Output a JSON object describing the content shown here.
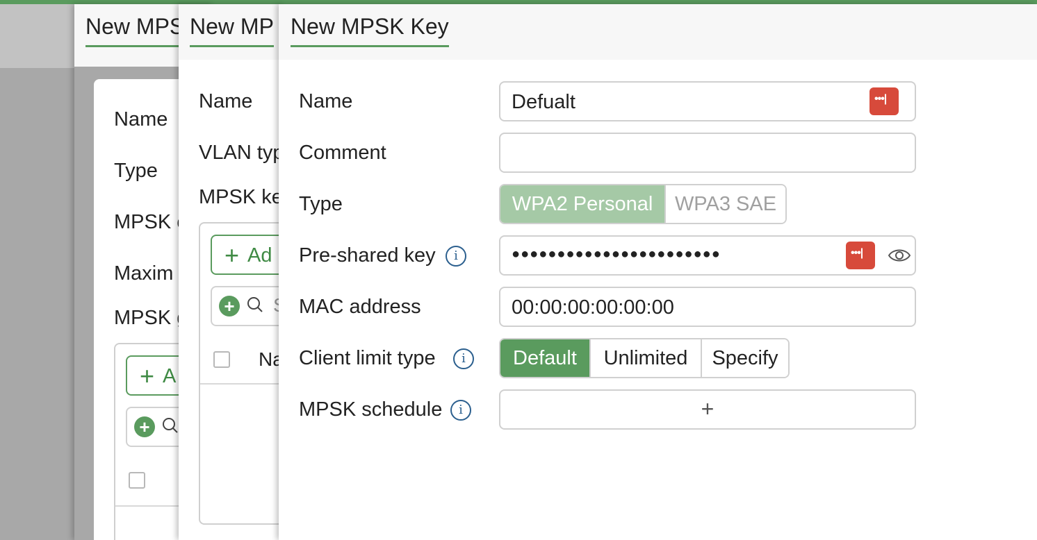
{
  "panels": {
    "back": {
      "title": "New MPS",
      "labels": [
        "Name",
        "Type",
        "MPSK c",
        "Maxim",
        "MPSK g"
      ],
      "add_label": "A",
      "checkbox_header": ""
    },
    "middle": {
      "title": "New MP",
      "labels": [
        "Name",
        "VLAN typ",
        "MPSK ke"
      ],
      "add_label": "Ad",
      "search_partial": "S",
      "column_header": "Na"
    },
    "front": {
      "title": "New MPSK Key",
      "name": {
        "label": "Name",
        "value": "Defualt"
      },
      "comment": {
        "label": "Comment",
        "value": ""
      },
      "type": {
        "label": "Type",
        "options": [
          "WPA2 Personal",
          "WPA3 SAE"
        ],
        "selected": "WPA2 Personal"
      },
      "psk": {
        "label": "Pre-shared key",
        "value": "●●●●●●●●●●●●●●●●●●●●●●●"
      },
      "mac": {
        "label": "MAC address",
        "value": "00:00:00:00:00:00"
      },
      "client_limit": {
        "label": "Client limit type",
        "options": [
          "Default",
          "Unlimited",
          "Specify"
        ],
        "selected": "Default"
      },
      "schedule": {
        "label": "MPSK schedule",
        "add": "+"
      },
      "password_manager_glyph": "•••|",
      "info_glyph": "i"
    }
  },
  "colors": {
    "accent_green": "#5a9b5e",
    "light_green": "#a5c9a6",
    "password_manager_red": "#d74a3b",
    "info_blue": "#2b5f8e"
  },
  "icons": [
    "password-manager-icon",
    "eye-icon",
    "info-icon",
    "search-icon",
    "add-plus-icon"
  ]
}
